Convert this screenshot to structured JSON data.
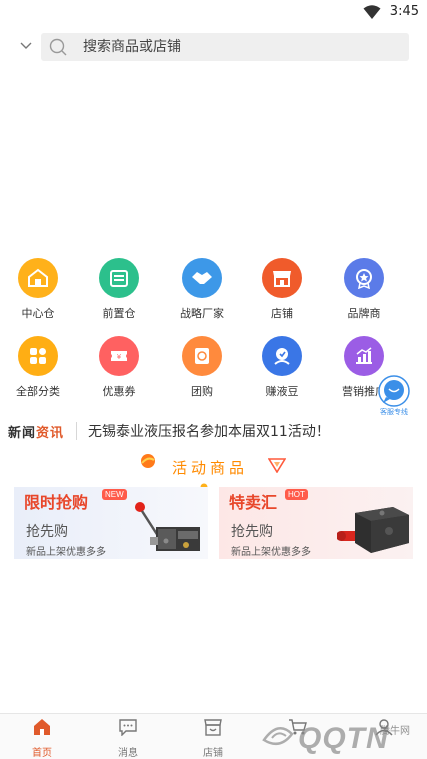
{
  "status": {
    "time": "3:45"
  },
  "search": {
    "placeholder": "搜索商品或店铺"
  },
  "grid": [
    {
      "label": "中心仓",
      "icon": "warehouse-icon",
      "color": "#ffb11a"
    },
    {
      "label": "前置仓",
      "icon": "storage-icon",
      "color": "#2cc08c"
    },
    {
      "label": "战略厂家",
      "icon": "handshake-icon",
      "color": "#3d98e8"
    },
    {
      "label": "店铺",
      "icon": "shop-icon",
      "color": "#f05b2b"
    },
    {
      "label": "品牌商",
      "icon": "medal-icon",
      "color": "#5b7be8"
    },
    {
      "label": "全部分类",
      "icon": "category-icon",
      "color": "#ffae14"
    },
    {
      "label": "优惠券",
      "icon": "coupon-icon",
      "color": "#ff6161"
    },
    {
      "label": "团购",
      "icon": "group-buy-icon",
      "color": "#ff8a3d"
    },
    {
      "label": "赚液豆",
      "icon": "bean-icon",
      "color": "#3a76e6"
    },
    {
      "label": "营销推广",
      "icon": "marketing-icon",
      "color": "#9b5de5"
    }
  ],
  "customer_service": {
    "label": "客服专线"
  },
  "news": {
    "tag_left": "新闻",
    "tag_right": "资讯",
    "text": "无锡泰业液压报名参加本届双11活动！"
  },
  "activity": {
    "title": "活动商品"
  },
  "cards": [
    {
      "title": "限时抢购",
      "badge": "NEW",
      "subtitle": "抢先购",
      "desc": "新品上架优惠多多"
    },
    {
      "title": "特卖汇",
      "badge": "HOT",
      "subtitle": "抢先购",
      "desc": "新品上架优惠多多"
    }
  ],
  "tabbar": [
    {
      "label": "首页",
      "icon": "home-icon"
    },
    {
      "label": "消息",
      "icon": "message-icon"
    },
    {
      "label": "店铺",
      "icon": "store-icon"
    },
    {
      "label": "",
      "icon": "cart-icon"
    },
    {
      "label": "",
      "icon": "user-icon"
    }
  ],
  "watermark": {
    "text": "QQTN",
    "sub": "腾牛网"
  },
  "colors": {
    "accent": "#e05a2b",
    "activity": "#ff8a00"
  }
}
